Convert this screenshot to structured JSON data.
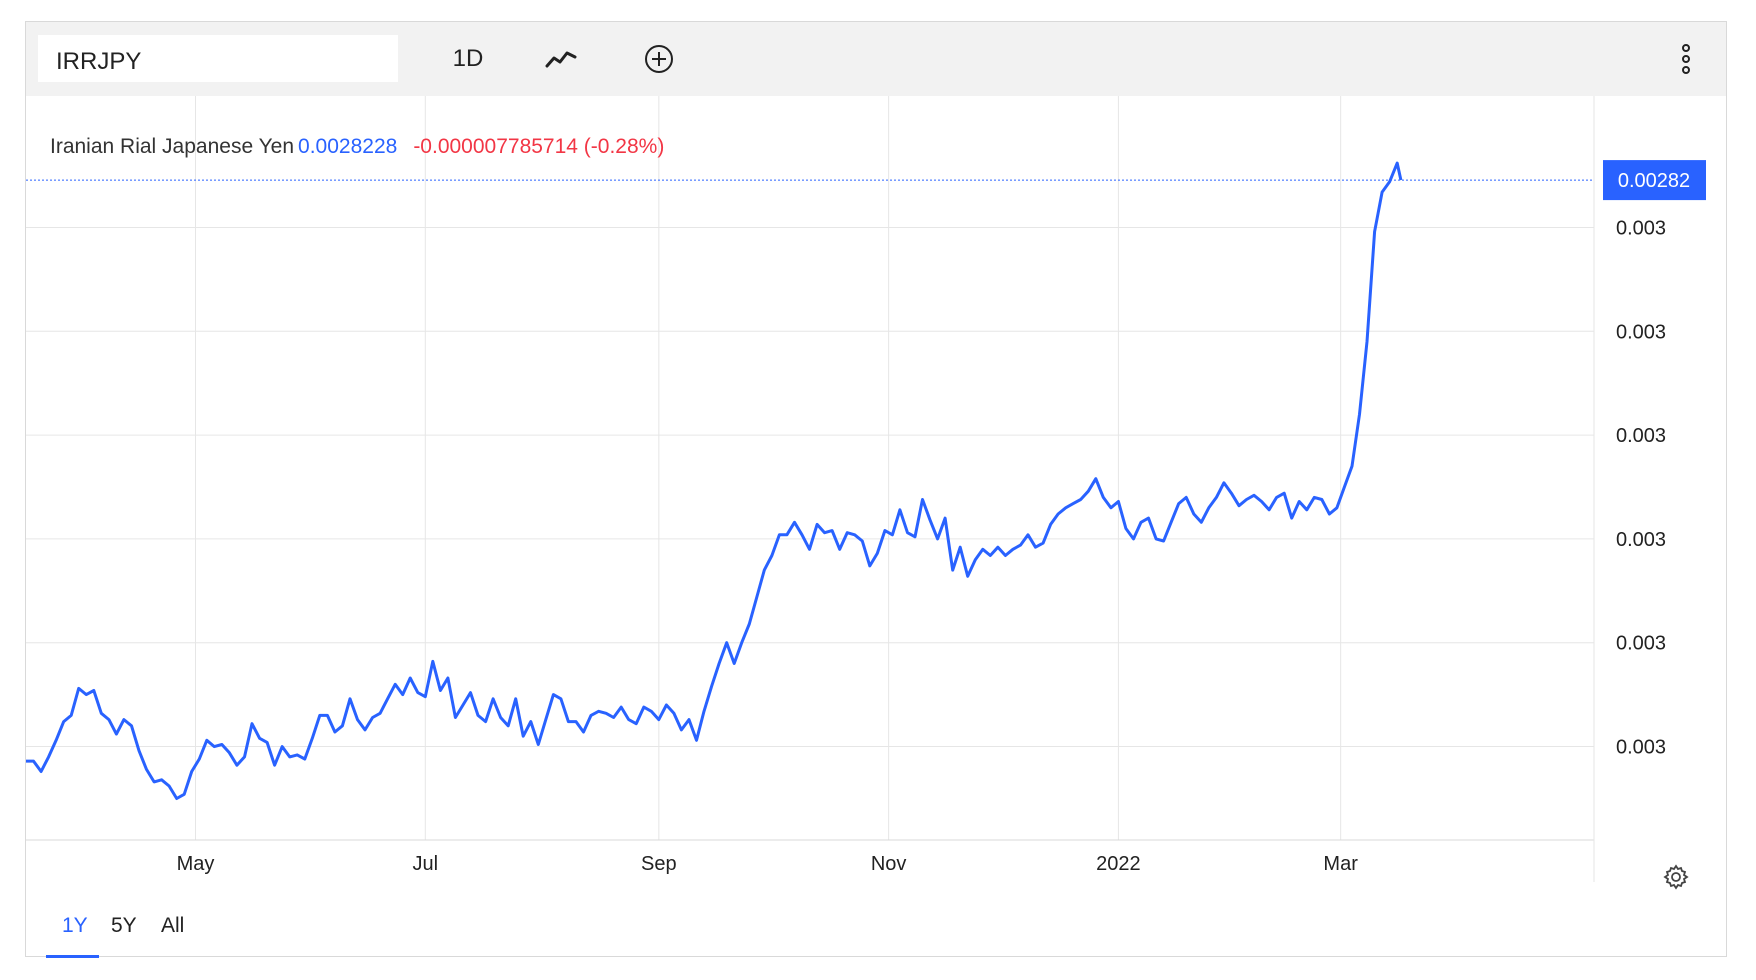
{
  "toolbar": {
    "symbol": "IRRJPY",
    "interval": "1D",
    "charttype_icon": "line-chart-icon",
    "add_icon": "plus-circle-icon",
    "more_icon": "vertical-dots-icon"
  },
  "legend": {
    "name": "Iranian Rial Japanese Yen",
    "price": "0.0028228",
    "change": "-0.000007785714 (-0.28%)"
  },
  "last_price_tag": "0.00282",
  "ranges": [
    "1Y",
    "5Y",
    "All"
  ],
  "active_range": "1Y",
  "settings_icon": "gear-icon",
  "colors": {
    "line": "#2962ff",
    "negative": "#f23645",
    "grid": "#e6e6e6",
    "toolbar_bg": "#f2f2f2"
  },
  "chart_data": {
    "type": "line",
    "title": "",
    "xlabel": "",
    "ylabel": "",
    "x_ticks": [
      {
        "label": "May",
        "date": "2021-05-01"
      },
      {
        "label": "Jul",
        "date": "2021-07-01"
      },
      {
        "label": "Sep",
        "date": "2021-09-01"
      },
      {
        "label": "Nov",
        "date": "2021-11-01"
      },
      {
        "label": "2022",
        "date": "2022-01-01"
      },
      {
        "label": "Mar",
        "date": "2022-03-01"
      }
    ],
    "y_ticks": [
      {
        "label": "0.003",
        "value": 0.0028
      },
      {
        "label": "0.003",
        "value": 0.00275
      },
      {
        "label": "0.003",
        "value": 0.0027
      },
      {
        "label": "0.003",
        "value": 0.00265
      },
      {
        "label": "0.003",
        "value": 0.0026
      },
      {
        "label": "0.003",
        "value": 0.00255
      }
    ],
    "ylim": [
      0.002505,
      0.002845
    ],
    "xlim": [
      "2021-03-17",
      "2022-03-21"
    ],
    "last_value": 0.0028228,
    "series": [
      {
        "points": [
          [
            "2021-03-17",
            0.002543
          ],
          [
            "2021-03-19",
            0.002543
          ],
          [
            "2021-03-21",
            0.002538
          ],
          [
            "2021-03-23",
            0.002545
          ],
          [
            "2021-03-25",
            0.002553
          ],
          [
            "2021-03-27",
            0.002562
          ],
          [
            "2021-03-29",
            0.002565
          ],
          [
            "2021-03-31",
            0.002578
          ],
          [
            "2021-04-02",
            0.002575
          ],
          [
            "2021-04-04",
            0.002577
          ],
          [
            "2021-04-06",
            0.002566
          ],
          [
            "2021-04-08",
            0.002563
          ],
          [
            "2021-04-10",
            0.002556
          ],
          [
            "2021-04-12",
            0.002563
          ],
          [
            "2021-04-14",
            0.00256
          ],
          [
            "2021-04-16",
            0.002548
          ],
          [
            "2021-04-18",
            0.002539
          ],
          [
            "2021-04-20",
            0.002533
          ],
          [
            "2021-04-22",
            0.002534
          ],
          [
            "2021-04-24",
            0.002531
          ],
          [
            "2021-04-26",
            0.002525
          ],
          [
            "2021-04-28",
            0.002527
          ],
          [
            "2021-04-30",
            0.002538
          ],
          [
            "2021-05-02",
            0.002544
          ],
          [
            "2021-05-04",
            0.002553
          ],
          [
            "2021-05-06",
            0.00255
          ],
          [
            "2021-05-08",
            0.002551
          ],
          [
            "2021-05-10",
            0.002547
          ],
          [
            "2021-05-12",
            0.002541
          ],
          [
            "2021-05-14",
            0.002545
          ],
          [
            "2021-05-16",
            0.002561
          ],
          [
            "2021-05-18",
            0.002554
          ],
          [
            "2021-05-20",
            0.002552
          ],
          [
            "2021-05-22",
            0.002541
          ],
          [
            "2021-05-24",
            0.00255
          ],
          [
            "2021-05-26",
            0.002545
          ],
          [
            "2021-05-28",
            0.002546
          ],
          [
            "2021-05-30",
            0.002544
          ],
          [
            "2021-06-01",
            0.002554
          ],
          [
            "2021-06-03",
            0.002565
          ],
          [
            "2021-06-05",
            0.002565
          ],
          [
            "2021-06-07",
            0.002557
          ],
          [
            "2021-06-09",
            0.00256
          ],
          [
            "2021-06-11",
            0.002573
          ],
          [
            "2021-06-13",
            0.002563
          ],
          [
            "2021-06-15",
            0.002558
          ],
          [
            "2021-06-17",
            0.002564
          ],
          [
            "2021-06-19",
            0.002566
          ],
          [
            "2021-06-21",
            0.002573
          ],
          [
            "2021-06-23",
            0.00258
          ],
          [
            "2021-06-25",
            0.002575
          ],
          [
            "2021-06-27",
            0.002583
          ],
          [
            "2021-06-29",
            0.002576
          ],
          [
            "2021-07-01",
            0.002574
          ],
          [
            "2021-07-03",
            0.002591
          ],
          [
            "2021-07-05",
            0.002577
          ],
          [
            "2021-07-07",
            0.002583
          ],
          [
            "2021-07-09",
            0.002564
          ],
          [
            "2021-07-11",
            0.00257
          ],
          [
            "2021-07-13",
            0.002576
          ],
          [
            "2021-07-15",
            0.002565
          ],
          [
            "2021-07-17",
            0.002562
          ],
          [
            "2021-07-19",
            0.002573
          ],
          [
            "2021-07-21",
            0.002564
          ],
          [
            "2021-07-23",
            0.00256
          ],
          [
            "2021-07-25",
            0.002573
          ],
          [
            "2021-07-27",
            0.002555
          ],
          [
            "2021-07-29",
            0.002562
          ],
          [
            "2021-07-31",
            0.002551
          ],
          [
            "2021-08-02",
            0.002563
          ],
          [
            "2021-08-04",
            0.002575
          ],
          [
            "2021-08-06",
            0.002573
          ],
          [
            "2021-08-08",
            0.002562
          ],
          [
            "2021-08-10",
            0.002562
          ],
          [
            "2021-08-12",
            0.002557
          ],
          [
            "2021-08-14",
            0.002565
          ],
          [
            "2021-08-16",
            0.002567
          ],
          [
            "2021-08-18",
            0.002566
          ],
          [
            "2021-08-20",
            0.002564
          ],
          [
            "2021-08-22",
            0.002569
          ],
          [
            "2021-08-24",
            0.002563
          ],
          [
            "2021-08-26",
            0.002561
          ],
          [
            "2021-08-28",
            0.002569
          ],
          [
            "2021-08-30",
            0.002567
          ],
          [
            "2021-09-01",
            0.002563
          ],
          [
            "2021-09-03",
            0.00257
          ],
          [
            "2021-09-05",
            0.002566
          ],
          [
            "2021-09-07",
            0.002558
          ],
          [
            "2021-09-09",
            0.002563
          ],
          [
            "2021-09-11",
            0.002553
          ],
          [
            "2021-09-13",
            0.002567
          ],
          [
            "2021-09-15",
            0.002579
          ],
          [
            "2021-09-17",
            0.00259
          ],
          [
            "2021-09-19",
            0.0026
          ],
          [
            "2021-09-21",
            0.00259
          ],
          [
            "2021-09-23",
            0.0026
          ],
          [
            "2021-09-25",
            0.002609
          ],
          [
            "2021-09-27",
            0.002622
          ],
          [
            "2021-09-29",
            0.002635
          ],
          [
            "2021-10-01",
            0.002642
          ],
          [
            "2021-10-03",
            0.002652
          ],
          [
            "2021-10-05",
            0.002652
          ],
          [
            "2021-10-07",
            0.002658
          ],
          [
            "2021-10-09",
            0.002652
          ],
          [
            "2021-10-11",
            0.002645
          ],
          [
            "2021-10-13",
            0.002657
          ],
          [
            "2021-10-15",
            0.002653
          ],
          [
            "2021-10-17",
            0.002654
          ],
          [
            "2021-10-19",
            0.002645
          ],
          [
            "2021-10-21",
            0.002653
          ],
          [
            "2021-10-23",
            0.002652
          ],
          [
            "2021-10-25",
            0.002649
          ],
          [
            "2021-10-27",
            0.002637
          ],
          [
            "2021-10-29",
            0.002643
          ],
          [
            "2021-10-31",
            0.002654
          ],
          [
            "2021-11-02",
            0.002652
          ],
          [
            "2021-11-04",
            0.002664
          ],
          [
            "2021-11-06",
            0.002653
          ],
          [
            "2021-11-08",
            0.002651
          ],
          [
            "2021-11-10",
            0.002669
          ],
          [
            "2021-11-12",
            0.002659
          ],
          [
            "2021-11-14",
            0.00265
          ],
          [
            "2021-11-16",
            0.00266
          ],
          [
            "2021-11-18",
            0.002635
          ],
          [
            "2021-11-20",
            0.002646
          ],
          [
            "2021-11-22",
            0.002632
          ],
          [
            "2021-11-24",
            0.00264
          ],
          [
            "2021-11-26",
            0.002645
          ],
          [
            "2021-11-28",
            0.002642
          ],
          [
            "2021-11-30",
            0.002646
          ],
          [
            "2021-12-02",
            0.002642
          ],
          [
            "2021-12-04",
            0.002645
          ],
          [
            "2021-12-06",
            0.002647
          ],
          [
            "2021-12-08",
            0.002652
          ],
          [
            "2021-12-10",
            0.002646
          ],
          [
            "2021-12-12",
            0.002648
          ],
          [
            "2021-12-14",
            0.002657
          ],
          [
            "2021-12-16",
            0.002662
          ],
          [
            "2021-12-18",
            0.002665
          ],
          [
            "2021-12-20",
            0.002667
          ],
          [
            "2021-12-22",
            0.002669
          ],
          [
            "2021-12-24",
            0.002673
          ],
          [
            "2021-12-26",
            0.002679
          ],
          [
            "2021-12-28",
            0.00267
          ],
          [
            "2021-12-30",
            0.002665
          ],
          [
            "2022-01-01",
            0.002668
          ],
          [
            "2022-01-03",
            0.002655
          ],
          [
            "2022-01-05",
            0.00265
          ],
          [
            "2022-01-07",
            0.002658
          ],
          [
            "2022-01-09",
            0.00266
          ],
          [
            "2022-01-11",
            0.00265
          ],
          [
            "2022-01-13",
            0.002649
          ],
          [
            "2022-01-15",
            0.002658
          ],
          [
            "2022-01-17",
            0.002667
          ],
          [
            "2022-01-19",
            0.00267
          ],
          [
            "2022-01-21",
            0.002662
          ],
          [
            "2022-01-23",
            0.002658
          ],
          [
            "2022-01-25",
            0.002665
          ],
          [
            "2022-01-27",
            0.00267
          ],
          [
            "2022-01-29",
            0.002677
          ],
          [
            "2022-01-31",
            0.002672
          ],
          [
            "2022-02-02",
            0.002666
          ],
          [
            "2022-02-04",
            0.002669
          ],
          [
            "2022-02-06",
            0.002671
          ],
          [
            "2022-02-08",
            0.002668
          ],
          [
            "2022-02-10",
            0.002664
          ],
          [
            "2022-02-12",
            0.00267
          ],
          [
            "2022-02-14",
            0.002672
          ],
          [
            "2022-02-16",
            0.00266
          ],
          [
            "2022-02-18",
            0.002668
          ],
          [
            "2022-02-20",
            0.002664
          ],
          [
            "2022-02-22",
            0.00267
          ],
          [
            "2022-02-24",
            0.002669
          ],
          [
            "2022-02-26",
            0.002662
          ],
          [
            "2022-02-28",
            0.002665
          ],
          [
            "2022-03-02",
            0.002675
          ],
          [
            "2022-03-04",
            0.002685
          ],
          [
            "2022-03-06",
            0.00271
          ],
          [
            "2022-03-08",
            0.002745
          ],
          [
            "2022-03-10",
            0.002798
          ],
          [
            "2022-03-12",
            0.002817
          ],
          [
            "2022-03-14",
            0.002822
          ],
          [
            "2022-03-16",
            0.002831
          ],
          [
            "2022-03-17",
            0.0028228
          ]
        ]
      }
    ]
  }
}
